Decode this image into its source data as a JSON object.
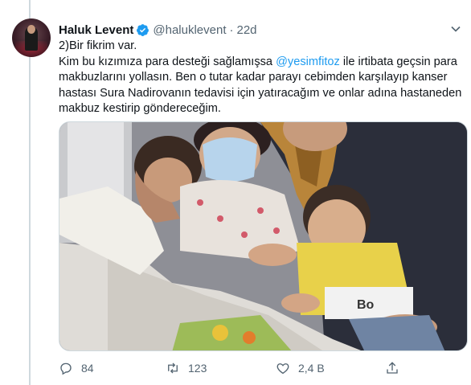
{
  "tweet": {
    "author_name": "Haluk Levent",
    "handle": "@haluklevent",
    "separator": "·",
    "time": "22d",
    "text": {
      "line1": "2)Bir fikrim var.",
      "line2_before": "Kim bu kızımıza para desteği sağlamışsa ",
      "line2_mention": "@yesimfitoz",
      "line2_after": " ile irtibata geçsin para",
      "line3": "makbuzlarını yollasın. Ben o tutar kadar parayı cebimden karşılayıp kanser",
      "line4": "hastası Sura Nadirovanın tedavisi için yatıracağım ve onlar adına hastaneden",
      "line5": "makbuz kestirip göndereceğim."
    },
    "media": {
      "image_text": "Bo"
    },
    "actions": {
      "reply_count": "84",
      "retweet_count": "123",
      "like_count": "2,4 B"
    }
  },
  "colors": {
    "text_primary": "#0f1419",
    "text_secondary": "#536471",
    "accent": "#1d9bf0",
    "thread_line": "#cfd9de"
  },
  "icons": {
    "verified": "verified-badge-icon",
    "more": "chevron-down-icon",
    "reply": "reply-icon",
    "retweet": "retweet-icon",
    "like": "heart-icon",
    "share": "share-icon"
  }
}
